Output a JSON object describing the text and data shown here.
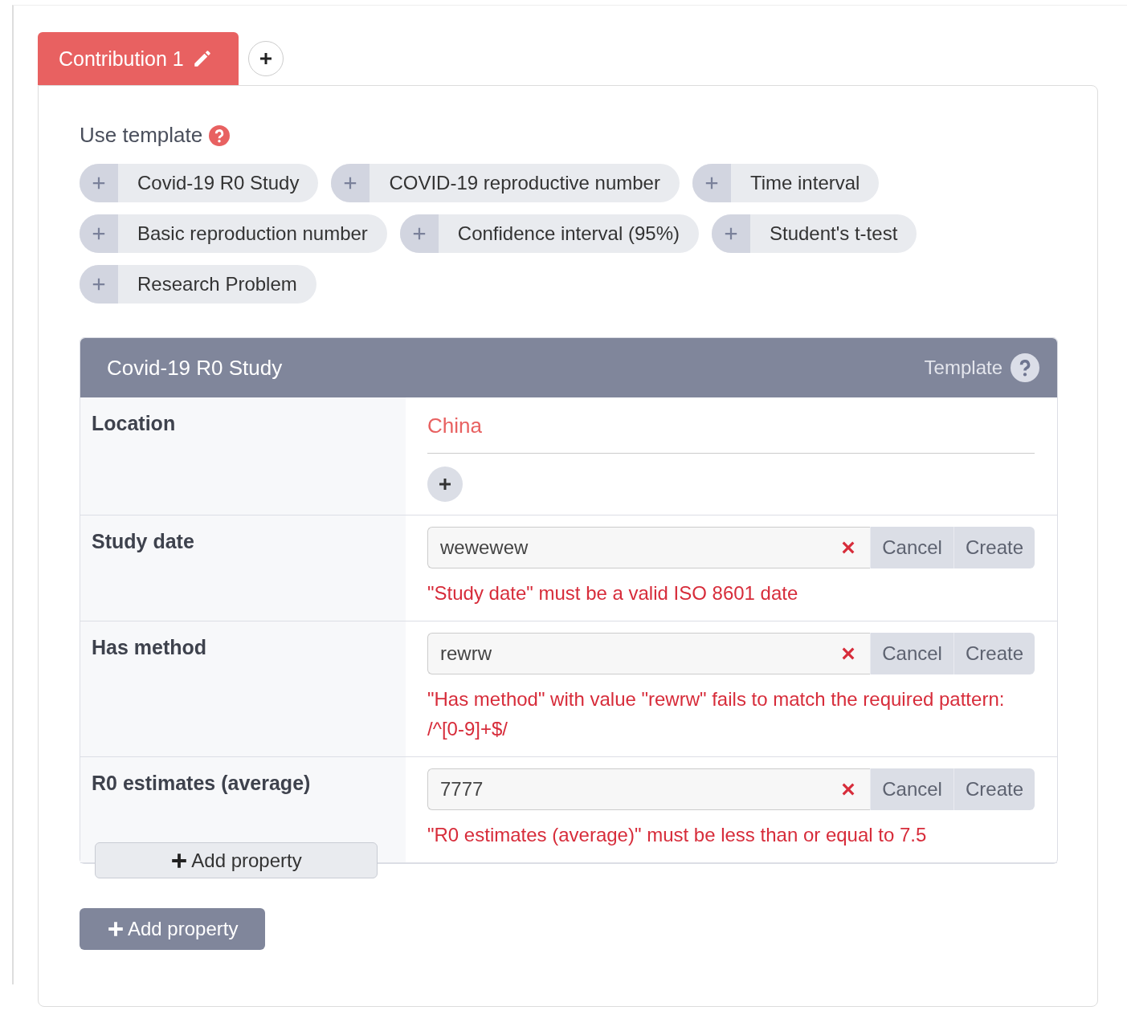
{
  "tabs": [
    {
      "label": "Contribution 1",
      "selected": true
    }
  ],
  "template_picker": {
    "label": "Use template",
    "chips": [
      {
        "label": "Covid-19 R0 Study"
      },
      {
        "label": "COVID-19 reproductive number"
      },
      {
        "label": "Time interval"
      },
      {
        "label": "Basic reproduction number"
      },
      {
        "label": "Confidence interval (95%)"
      },
      {
        "label": "Student's t-test"
      },
      {
        "label": "Research Problem"
      }
    ]
  },
  "template": {
    "title": "Covid-19 R0 Study",
    "badge": "Template",
    "properties": [
      {
        "label": "Location",
        "kind": "resource",
        "value": "China"
      },
      {
        "label": "Study date",
        "kind": "input",
        "value": "wewewew",
        "error": "\"Study date\" must be a valid ISO 8601 date",
        "cancel": "Cancel",
        "create": "Create"
      },
      {
        "label": "Has method",
        "kind": "input",
        "value": "rewrw",
        "error": "\"Has method\" with value \"rewrw\" fails to match the required pattern: /^[0-9]+$/",
        "cancel": "Cancel",
        "create": "Create"
      },
      {
        "label": "R0 estimates (average)",
        "kind": "input",
        "value": "7777",
        "error": "\"R0 estimates (average)\" must be less than or equal to 7.5",
        "cancel": "Cancel",
        "create": "Create"
      }
    ],
    "add_property": "Add property"
  },
  "add_property": "Add property"
}
